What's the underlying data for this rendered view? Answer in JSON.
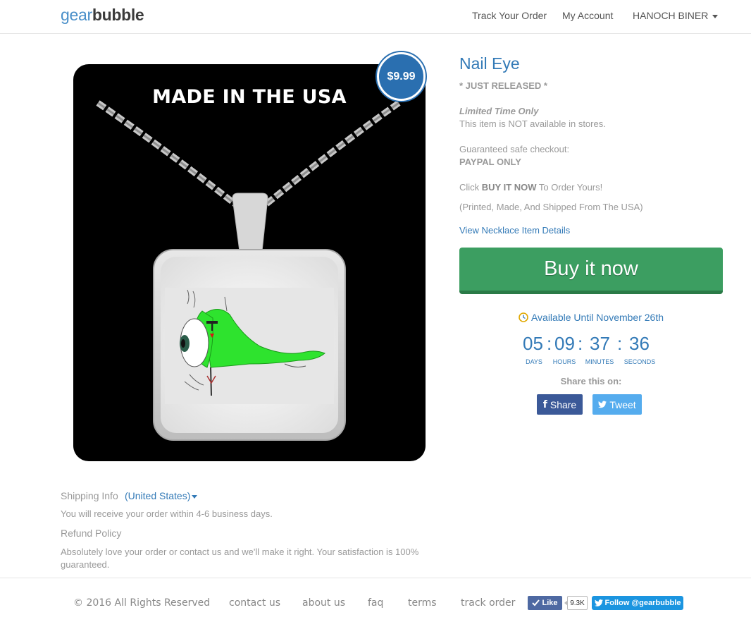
{
  "header": {
    "logo_gear": "gear",
    "logo_bubble": "bubble",
    "nav": {
      "track": "Track Your Order",
      "account": "My Account",
      "user": "HANOCH BINER"
    }
  },
  "product": {
    "image_banner": "MADE IN THE USA",
    "price": "$9.99",
    "title": "Nail Eye",
    "just_released": "* JUST RELEASED *",
    "limited": "Limited Time Only",
    "not_available": "This item is NOT available in stores.",
    "guaranteed": "Guaranteed safe checkout:",
    "paypal": "PAYPAL ONLY",
    "click_prefix": "Click ",
    "click_bold": "BUY IT NOW",
    "click_suffix": " To Order Yours!",
    "printed": "(Printed, Made, And Shipped From The USA)",
    "view_details": "View Necklace Item Details",
    "buy_button": "Buy it now",
    "available_until": "Available Until November 26th"
  },
  "countdown": {
    "days": "05",
    "hours": "09",
    "minutes": "37",
    "seconds": "36",
    "days_label": "DAYS",
    "hours_label": "HOURS",
    "minutes_label": "MINUTES",
    "seconds_label": "SECONDS",
    "separator": ":"
  },
  "share": {
    "label": "Share this on:",
    "facebook": "Share",
    "facebook_icon": "f",
    "twitter": "Tweet"
  },
  "shipping": {
    "label": "Shipping Info",
    "country": "(United States)",
    "days": "You will receive your order within 4-6 business days.",
    "refund_label": "Refund Policy",
    "refund_text": "Absolutely love your order or contact us and we'll make it right. Your satisfaction is 100% guaranteed."
  },
  "footer": {
    "copyright": "© 2016 All Rights Reserved",
    "contact": "contact us",
    "about": "about us",
    "faq": "faq",
    "terms": "terms",
    "track": "track order",
    "fb_like": "Like",
    "fb_count": "9.3K",
    "tw_follow": "Follow @gearbubble"
  },
  "colors": {
    "brand_blue": "#337ab7",
    "buy_green": "#3c9e61",
    "facebook": "#3b5998",
    "twitter": "#55acee"
  }
}
